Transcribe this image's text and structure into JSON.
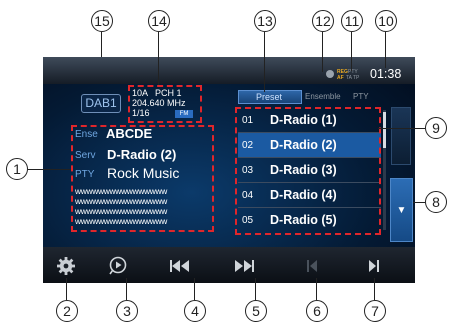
{
  "callouts": [
    "1",
    "2",
    "3",
    "4",
    "5",
    "6",
    "7",
    "8",
    "9",
    "10",
    "11",
    "12",
    "13",
    "14",
    "15"
  ],
  "status": {
    "clock": "01:38",
    "reg": "REG",
    "pty": "PTY",
    "af": "AF",
    "ta": "TA",
    "tp": "TP"
  },
  "header": {
    "band": "DAB1",
    "line1": "10A   PCH 1",
    "freq": "204.640 MHz",
    "index": "1/16",
    "fm_badge": "FM"
  },
  "info": {
    "ense_label": "Ense",
    "ense_value": "ABCDE",
    "serv_label": "Serv",
    "serv_value": "D-Radio (2)",
    "pty_label": "PTY",
    "pty_value": "Rock Music",
    "text_lines": [
      "wwwwwwwwwwwwwwww",
      "wwwwwwwwwwwwwwww",
      "wwwwwwwwwwwwwwww",
      "wwwwwwwwwwwwwwww"
    ]
  },
  "tabs": [
    "Preset",
    "Ensemble",
    "PTY"
  ],
  "presets": [
    {
      "num": "01",
      "name": "D-Radio (1)"
    },
    {
      "num": "02",
      "name": "D-Radio (2)"
    },
    {
      "num": "03",
      "name": "D-Radio (3)"
    },
    {
      "num": "04",
      "name": "D-Radio (4)"
    },
    {
      "num": "05",
      "name": "D-Radio (5)"
    }
  ],
  "colors": {
    "accent": "#1b5aa2",
    "marker": "#e0262b"
  }
}
